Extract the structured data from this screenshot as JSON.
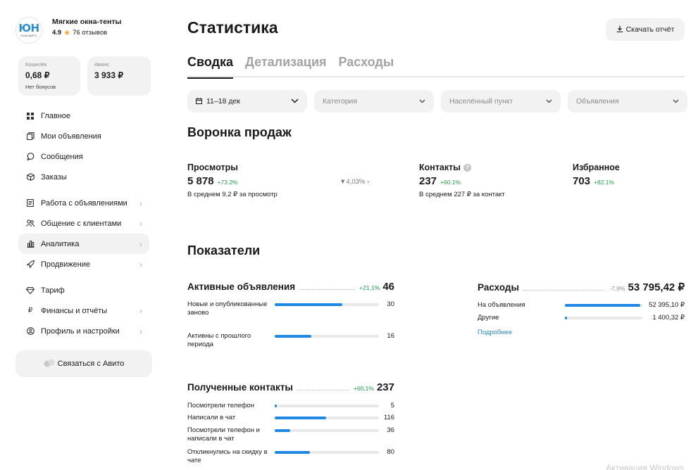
{
  "profile": {
    "logo_mark": "ЮН",
    "logo_sub": "ЮНАЛАЙТС",
    "name": "Мягкие окна-тенты",
    "rating": "4.9",
    "reviews": "76 отзывов"
  },
  "wallet": {
    "label": "Кошелёк",
    "value": "0,68 ₽",
    "note": "Нет бонусов",
    "advance_label": "Аванс",
    "advance_value": "3 933 ₽"
  },
  "nav": [
    {
      "label": "Главное",
      "icon": "grid-icon"
    },
    {
      "label": "Мои объявления",
      "icon": "copy-icon"
    },
    {
      "label": "Сообщения",
      "icon": "chat-icon"
    },
    {
      "label": "Заказы",
      "icon": "box-icon"
    },
    {
      "label": "Работа с объявлениями",
      "icon": "document-icon"
    },
    {
      "label": "Общение с клиентами",
      "icon": "users-icon"
    },
    {
      "label": "Аналитика",
      "icon": "bar-chart-icon"
    },
    {
      "label": "Продвижение",
      "icon": "rocket-icon"
    },
    {
      "label": "Тариф",
      "icon": "diamond-icon"
    },
    {
      "label": "Финансы и отчёты",
      "icon": "ruble-icon"
    },
    {
      "label": "Профиль и настройки",
      "icon": "profile-icon"
    }
  ],
  "contact_button": "Связаться с Авито",
  "page_title": "Статистика",
  "download_label": "Скачать отчёт",
  "tabs": [
    "Сводка",
    "Детализация",
    "Расходы"
  ],
  "filters": {
    "dates": "11–18 дек",
    "category": "Категория",
    "city": "Населённый пункт",
    "ads": "Объявления"
  },
  "funnel": {
    "title": "Воронка продаж",
    "views": {
      "label": "Просмотры",
      "value": "5 878",
      "delta": "+73.2%",
      "note": "В среднем 9,2 ₽ за просмотр"
    },
    "conversion": "4,03%",
    "contacts": {
      "label": "Контакты",
      "value": "237",
      "delta": "+60.1%",
      "note": "В среднем 227 ₽ за контакт"
    },
    "favorites": {
      "label": "Избранное",
      "value": "703",
      "delta": "+82.1%"
    }
  },
  "indicators": {
    "title": "Показатели",
    "active_ads": {
      "title": "Активные объявления",
      "delta": "+21,1%",
      "value": "46",
      "rows": [
        {
          "label": "Новые и опубликованные заново",
          "value": "30",
          "fraction": 0.65
        },
        {
          "label": "Активны с прошлого периода",
          "value": "16",
          "fraction": 0.35
        }
      ]
    },
    "expenses": {
      "title": "Расходы",
      "delta": "-7,9%",
      "value": "53 795,42 ₽",
      "rows": [
        {
          "label": "На объявления",
          "value": "52 395,10 ₽",
          "fraction": 0.97
        },
        {
          "label": "Другие",
          "value": "1 400,32 ₽",
          "fraction": 0.03
        }
      ],
      "link": "Подробнее"
    },
    "contacts": {
      "title": "Полученные контакты",
      "delta": "+60,1%",
      "value": "237",
      "rows": [
        {
          "label": "Посмотрели телефон",
          "value": "5",
          "fraction": 0.02
        },
        {
          "label": "Написали в чат",
          "value": "116",
          "fraction": 0.49
        },
        {
          "label": "Посмотрели телефон и написали в чат",
          "value": "36",
          "fraction": 0.15
        },
        {
          "label": "Откликнулись на скидку в чате",
          "value": "80",
          "fraction": 0.34
        }
      ]
    }
  },
  "watermark": "Активация Windows"
}
